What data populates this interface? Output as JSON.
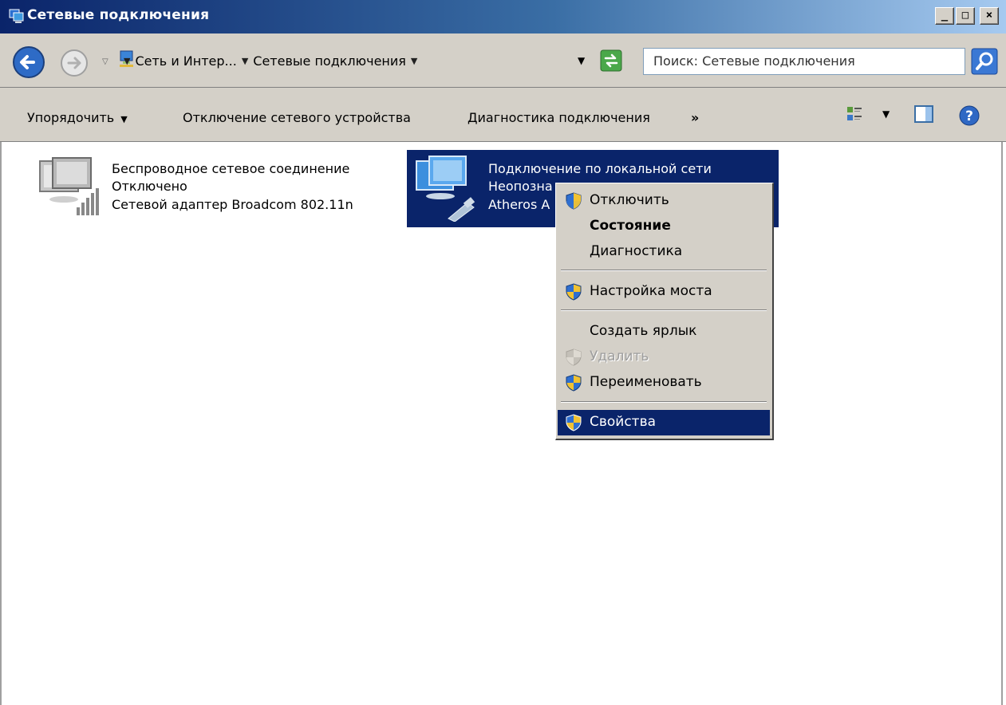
{
  "window": {
    "title": "Сетевые подключения"
  },
  "address": {
    "crumbs": [
      "Сеть и Интер...",
      "Сетевые подключения"
    ],
    "search_placeholder": "Поиск: Сетевые подключения"
  },
  "toolbar": {
    "organize": "Упорядочить",
    "disable_device": "Отключение сетевого устройства",
    "diagnose": "Диагностика подключения",
    "more": "»"
  },
  "connections": [
    {
      "name": "Беспроводное сетевое соединение",
      "status": "Отключено",
      "adapter": "Сетевой адаптер Broadcom 802.11n"
    },
    {
      "name": "Подключение по локальной сети",
      "status": "Неопозна",
      "adapter": "Atheros A"
    }
  ],
  "context_menu": {
    "disable": "Отключить",
    "status": "Состояние",
    "diagnostics": "Диагностика",
    "bridge": "Настройка моста",
    "shortcut": "Создать ярлык",
    "delete": "Удалить",
    "rename": "Переименовать",
    "properties": "Свойства"
  },
  "colors": {
    "selection": "#0a246a",
    "face": "#d4d0c8"
  }
}
